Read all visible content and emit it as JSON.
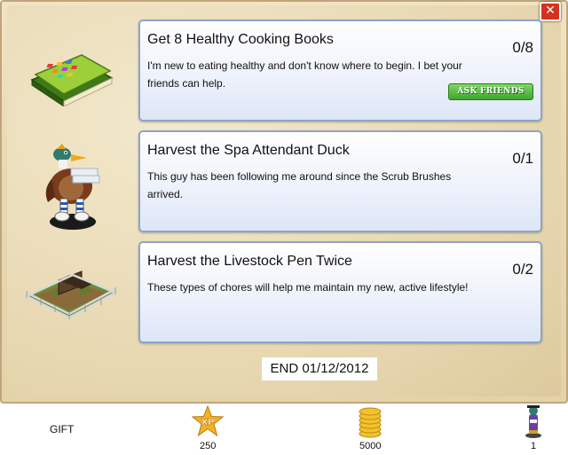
{
  "close_label": "✕",
  "quests": [
    {
      "title": "Get 8 Healthy Cooking Books",
      "description": "I'm new to eating healthy and don't know where to begin. I bet your friends can help.",
      "progress": "0/8",
      "action": "ASK FRIENDS",
      "icon": "cooking-book-icon"
    },
    {
      "title": "Harvest the Spa Attendant Duck",
      "description": "This guy has been following me around since the Scrub Brushes arrived.",
      "progress": "0/1",
      "icon": "spa-duck-icon"
    },
    {
      "title": "Harvest the Livestock Pen Twice",
      "description": "These types of chores will help me maintain my new, active lifestyle!",
      "progress": "0/2",
      "icon": "livestock-pen-icon"
    }
  ],
  "end_date": "END 01/12/2012",
  "rewards": {
    "gift_label": "GIFT",
    "xp_icon_text": "XP",
    "xp": "250",
    "coins": "5000",
    "item": "1"
  }
}
